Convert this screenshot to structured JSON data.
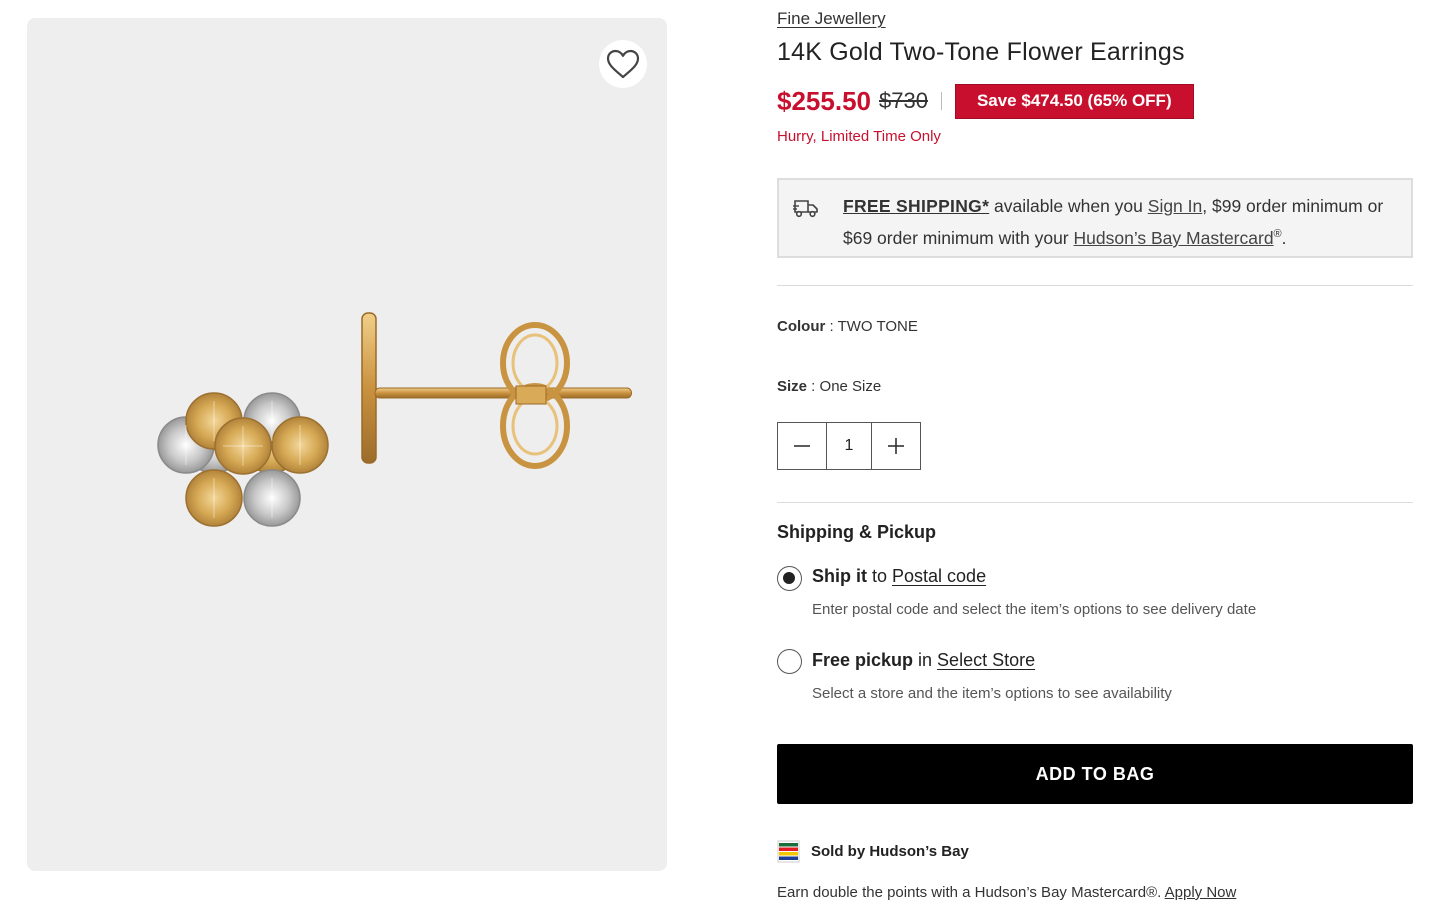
{
  "product": {
    "breadcrumb": "Fine Jewellery",
    "title": "14K Gold Two-Tone Flower Earrings",
    "price_sale": "$255.50",
    "price_original": "$730",
    "save_badge": "Save $474.50 (65% OFF)",
    "urgency": "Hurry, Limited Time Only"
  },
  "shipping_banner": {
    "free_shipping": "FREE SHIPPING*",
    "text_1": " available when you ",
    "sign_in": "Sign In",
    "text_2": ", $99 order minimum or $69 order minimum with your ",
    "card_link": "Hudson’s Bay Mastercard",
    "reg": "®",
    "end": "."
  },
  "options": {
    "colour_label": "Colour",
    "colour_value": "TWO TONE",
    "size_label": "Size",
    "size_value": "One Size",
    "quantity": "1"
  },
  "fulfillment": {
    "title": "Shipping & Pickup",
    "ship": {
      "bold": "Ship it",
      "mid": " to ",
      "link": "Postal code",
      "help": "Enter postal code and select the item’s options to see delivery date",
      "selected": true
    },
    "pickup": {
      "bold": "Free pickup",
      "mid": " in ",
      "link": "Select Store",
      "help": "Select a store and the item’s options to see availability",
      "selected": false
    }
  },
  "cta": {
    "add_to_bag": "ADD TO BAG"
  },
  "seller": {
    "label": "Sold by Hudson’s Bay"
  },
  "promo": {
    "text": "Earn double the points with a Hudson’s Bay Mastercard®. ",
    "link": "Apply Now"
  },
  "icons": {
    "wishlist": "heart-outline-icon",
    "shipping": "delivery-truck-icon",
    "seller": "hudsons-bay-stripes-icon"
  },
  "colors": {
    "sale_red": "#c8102e",
    "cta_black": "#000000",
    "image_bg": "#eeeeee"
  }
}
